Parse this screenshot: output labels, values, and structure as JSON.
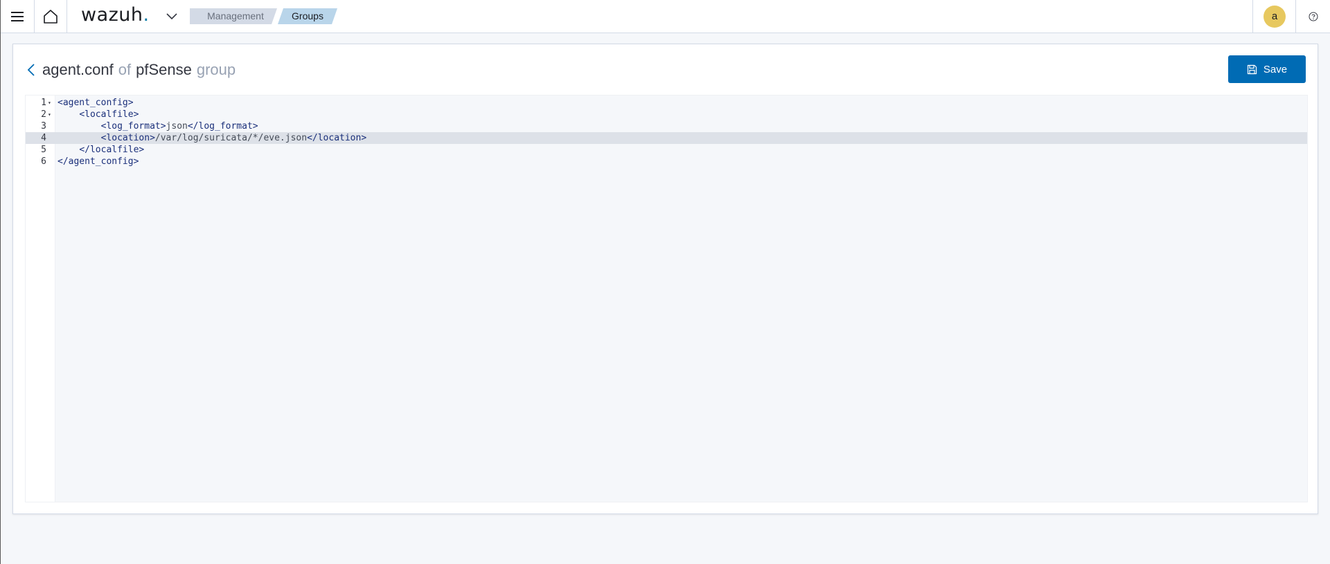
{
  "header": {
    "logo_text": "wazuh",
    "logo_dot": ".",
    "breadcrumbs": [
      {
        "label": "Management"
      },
      {
        "label": "Groups"
      }
    ],
    "user_initial": "a"
  },
  "panel": {
    "filename": "agent.conf",
    "of_word": "of",
    "group_name": "pfSense",
    "group_word": "group",
    "save_label": "Save"
  },
  "editor": {
    "lines": [
      {
        "num": "1",
        "foldable": true,
        "indent": "",
        "tag_open": "<agent_config>",
        "text": "",
        "tag_close": ""
      },
      {
        "num": "2",
        "foldable": true,
        "indent": "    ",
        "tag_open": "<localfile>",
        "text": "",
        "tag_close": ""
      },
      {
        "num": "3",
        "foldable": false,
        "indent": "        ",
        "tag_open": "<log_format>",
        "text": "json",
        "tag_close": "</log_format>"
      },
      {
        "num": "4",
        "foldable": false,
        "indent": "        ",
        "tag_open": "<location>",
        "text": "/var/log/suricata/*/eve.json",
        "tag_close": "</location>"
      },
      {
        "num": "5",
        "foldable": false,
        "indent": "    ",
        "tag_open": "</localfile>",
        "text": "",
        "tag_close": ""
      },
      {
        "num": "6",
        "foldable": false,
        "indent": "",
        "tag_open": "</agent_config>",
        "text": "",
        "tag_close": ""
      }
    ],
    "active_line": "4"
  },
  "colors": {
    "primary": "#006bb4",
    "avatar": "#e7c85f",
    "crumb_active": "#b9d5ea",
    "crumb_inactive": "#d3dae6"
  },
  "icons": {
    "menu": "hamburger-icon",
    "home": "home-icon",
    "chevron": "chevron-down-icon",
    "back": "arrow-left-icon",
    "save": "save-icon",
    "help": "help-icon"
  }
}
